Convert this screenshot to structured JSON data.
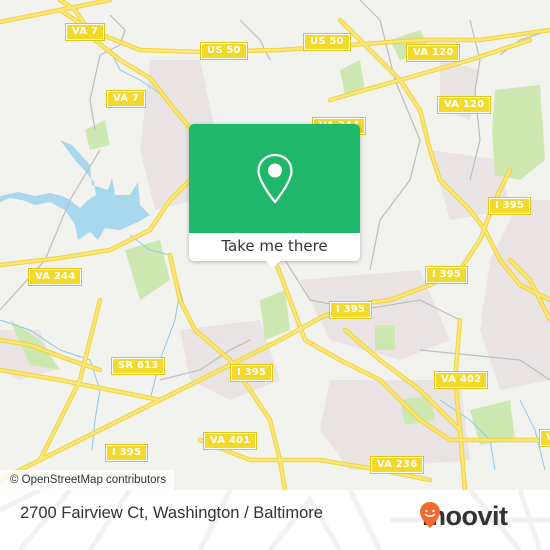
{
  "map": {
    "colors": {
      "background": "#f2f2ef",
      "road": "#f7df4a",
      "water": "#a8d8ee",
      "park": "#c8e6a8",
      "urban": "#e8e2e2",
      "minor_road": "#b8b8b8"
    },
    "road_labels": [
      {
        "id": "va7-top",
        "text": "VA 7"
      },
      {
        "id": "us50-left",
        "text": "US 50"
      },
      {
        "id": "us50-right",
        "text": "US 50"
      },
      {
        "id": "va120-top",
        "text": "VA 120"
      },
      {
        "id": "va7-mid",
        "text": "VA 7"
      },
      {
        "id": "va244-top",
        "text": "VA 244"
      },
      {
        "id": "va120-mid",
        "text": "VA 120"
      },
      {
        "id": "i395-ne",
        "text": "I 395"
      },
      {
        "id": "va244-left",
        "text": "VA 244"
      },
      {
        "id": "i395-east",
        "text": "I 395"
      },
      {
        "id": "i395-center",
        "text": "I 395"
      },
      {
        "id": "sr613",
        "text": "SR 613"
      },
      {
        "id": "i395-south",
        "text": "I 395"
      },
      {
        "id": "va402",
        "text": "VA 402"
      },
      {
        "id": "va401",
        "text": "VA 401"
      },
      {
        "id": "i395-sw",
        "text": "I 395"
      },
      {
        "id": "va236",
        "text": "VA 236"
      },
      {
        "id": "va-edge",
        "text": "V"
      }
    ],
    "attribution": "© OpenStreetMap contributors"
  },
  "popup": {
    "icon": "map-pin-icon",
    "button_label": "Take me there",
    "accent": "#1fb76a"
  },
  "footer": {
    "address": "2700 Fairview Ct, Washington / Baltimore",
    "brand": "moovit",
    "brand_icon": "moovit-pin-smile-icon",
    "brand_color": "#f26a2e"
  }
}
